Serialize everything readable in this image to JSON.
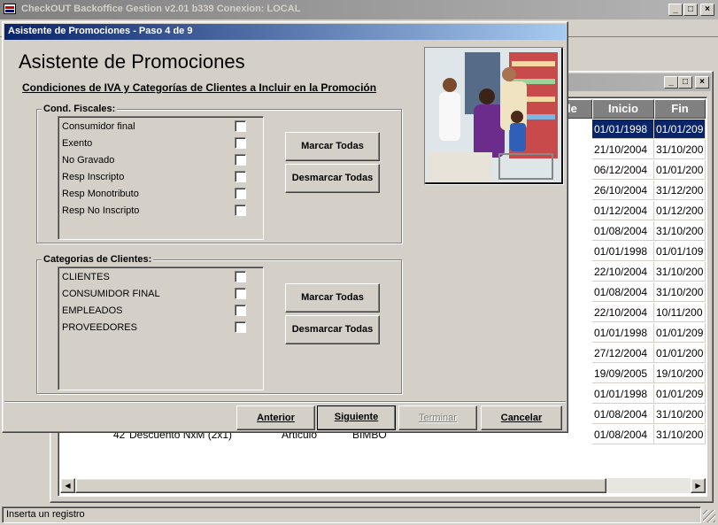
{
  "app": {
    "title": "CheckOUT Backoffice Gestion v2.01 b339 Conexion: LOCAL",
    "status_text": "Inserta un registro"
  },
  "back_table": {
    "headers": [
      "le",
      "Inicio",
      "Fin"
    ],
    "rows": [
      [
        "01/01/1998",
        "01/01/209"
      ],
      [
        "21/10/2004",
        "31/10/200"
      ],
      [
        "06/12/2004",
        "01/01/200"
      ],
      [
        "26/10/2004",
        "31/12/200"
      ],
      [
        "01/12/2004",
        "01/12/200"
      ],
      [
        "01/08/2004",
        "31/10/200"
      ],
      [
        "01/01/1998",
        "01/01/109"
      ],
      [
        "22/10/2004",
        "31/10/200"
      ],
      [
        "01/08/2004",
        "31/10/200"
      ],
      [
        "22/10/2004",
        "10/11/200"
      ],
      [
        "01/01/1998",
        "01/01/209"
      ],
      [
        "27/12/2004",
        "01/01/200"
      ],
      [
        "19/09/2005",
        "19/10/200"
      ],
      [
        "01/01/1998",
        "01/01/209"
      ],
      [
        "01/08/2004",
        "31/10/200"
      ],
      [
        "01/08/2004",
        "31/10/200"
      ]
    ],
    "last_row": {
      "num": "42",
      "desc": "Descuento NxM (2x1)",
      "tipo": "Articulo",
      "marca": "BIMBO"
    }
  },
  "wizard": {
    "title": "Asistente de Promociones - Paso 4 de 9",
    "heading": "Asistente de Promociones",
    "subheading": "Condiciones de IVA y Categorías de Clientes a Incluir en la Promoción",
    "fiscal_group": {
      "title": "Cond. Fiscales:",
      "items": [
        "Consumidor final",
        "Exento",
        "No Gravado",
        "Resp Inscripto",
        "Resp Monotributo",
        "Resp No Inscripto"
      ],
      "mark_all": "Marcar Todas",
      "unmark_all": "Desmarcar Todas"
    },
    "client_group": {
      "title": "Categorias de Clientes:",
      "items": [
        "CLIENTES",
        "CONSUMIDOR FINAL",
        "EMPLEADOS",
        "PROVEEDORES"
      ],
      "mark_all": "Marcar Todas",
      "unmark_all": "Desmarcar Todas"
    },
    "buttons": {
      "back": "Anterior",
      "next": "Siguiente",
      "finish": "Terminar",
      "cancel": "Cancelar"
    }
  },
  "colors": {
    "title_active": "#0a246a",
    "title_inactive": "#808080",
    "selection": "#0a246a",
    "header_bg": "#808080"
  }
}
